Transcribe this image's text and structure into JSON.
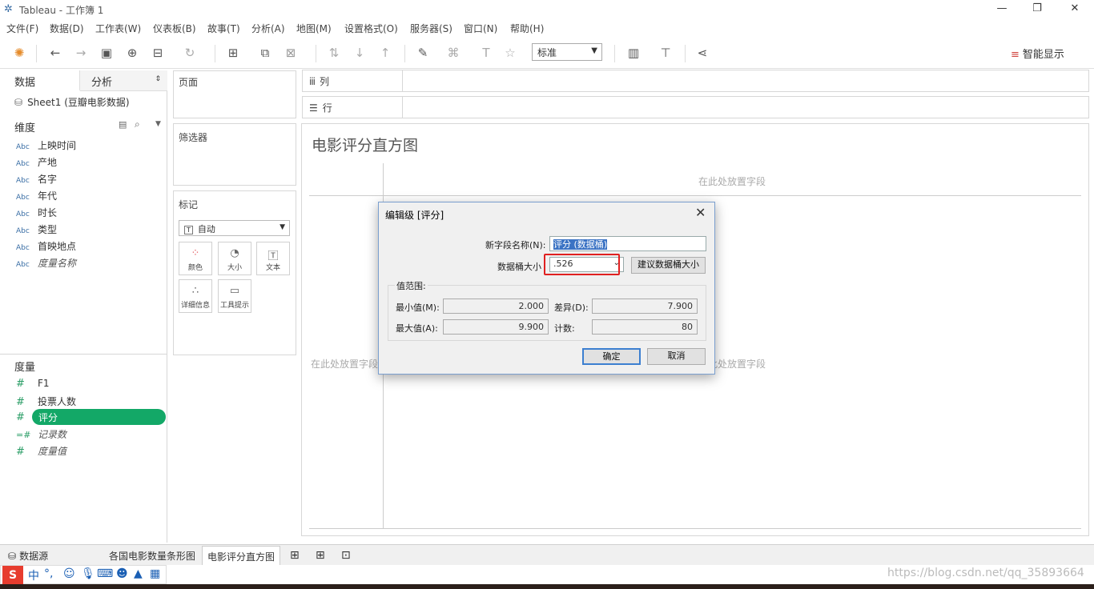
{
  "window": {
    "title": "Tableau - 工作簿 1",
    "min": "—",
    "restore": "❐",
    "close": "✕"
  },
  "menu": [
    "文件(F)",
    "数据(D)",
    "工作表(W)",
    "仪表板(B)",
    "故事(T)",
    "分析(A)",
    "地图(M)",
    "设置格式(O)",
    "服务器(S)",
    "窗口(N)",
    "帮助(H)"
  ],
  "toolbar": {
    "fit_select": "标准",
    "smart_show": "智能显示"
  },
  "left": {
    "tab_data": "数据",
    "tab_analysis": "分析",
    "datasource": "Sheet1 (豆瓣电影数据)",
    "dimensions_header": "维度",
    "dimensions": [
      {
        "type": "Abc",
        "name": "上映时间"
      },
      {
        "type": "Abc",
        "name": "产地"
      },
      {
        "type": "Abc",
        "name": "名字"
      },
      {
        "type": "Abc",
        "name": "年代"
      },
      {
        "type": "Abc",
        "name": "时长"
      },
      {
        "type": "Abc",
        "name": "类型"
      },
      {
        "type": "Abc",
        "name": "首映地点"
      },
      {
        "type": "Abc",
        "name": "度量名称"
      }
    ],
    "measures_header": "度量",
    "measures": [
      {
        "type": "#",
        "name": "F1"
      },
      {
        "type": "#",
        "name": "投票人数"
      },
      {
        "type": "#",
        "name": "评分"
      },
      {
        "type": "=#",
        "name": "记录数"
      },
      {
        "type": "#",
        "name": "度量值"
      }
    ]
  },
  "shelves": {
    "pages": "页面",
    "filters": "筛选器",
    "marks": "标记",
    "marks_type": "自动",
    "mark_buttons": [
      "颜色",
      "大小",
      "文本",
      "详细信息",
      "工具提示"
    ],
    "columns": "列",
    "rows": "行"
  },
  "view": {
    "title": "电影评分直方图",
    "drop_top": "在此处放置字段",
    "drop_left": "在此处放置字段",
    "drop_right": "在此处放置字段"
  },
  "dialog": {
    "title": "编辑级 [评分]",
    "new_field_label": "新字段名称(N):",
    "new_field_value": "评分 (数据桶)",
    "bin_size_label": "数据桶大小",
    "bin_size_value": ".526",
    "suggest_button": "建议数据桶大小",
    "range_label": "值范围:",
    "min_label": "最小值(M):",
    "min_value": "2.000",
    "diff_label": "差异(D):",
    "diff_value": "7.900",
    "max_label": "最大值(A):",
    "max_value": "9.900",
    "count_label": "计数:",
    "count_value": "80",
    "ok": "确定",
    "cancel": "取消"
  },
  "bottom": {
    "datasource_tab": "数据源",
    "sheet1": "各国电影数量条形图",
    "sheet2": "电影评分直方图"
  },
  "ime": {
    "logo": "S",
    "lang": "中"
  },
  "watermark": "https://blog.csdn.net/qq_35893664"
}
